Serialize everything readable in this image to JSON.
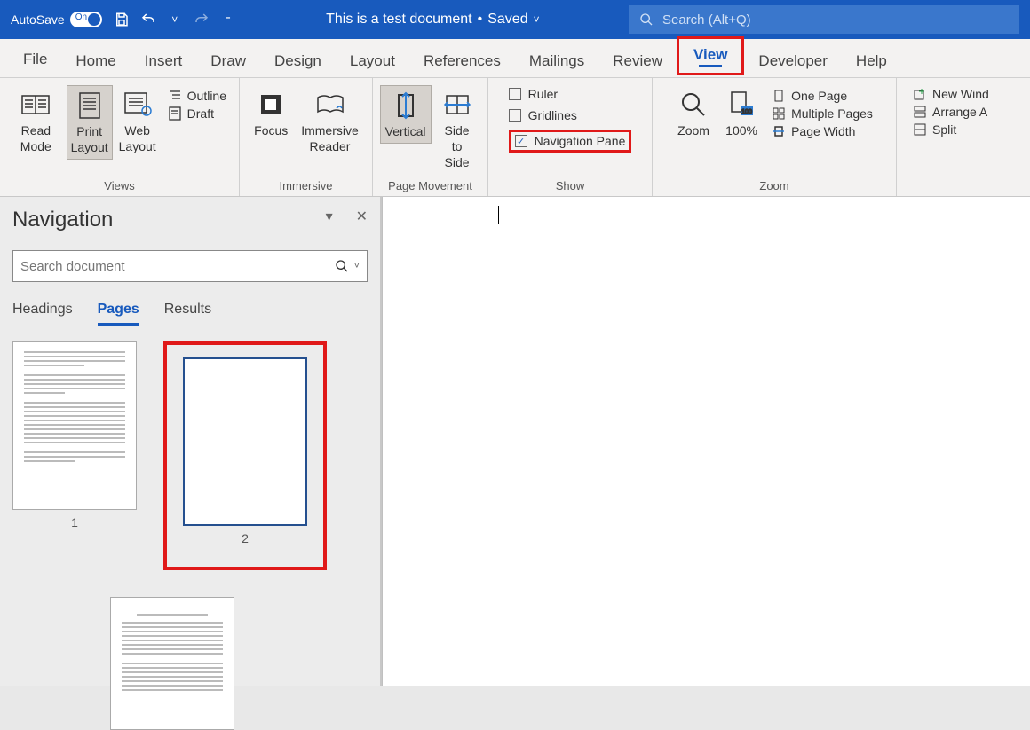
{
  "titlebar": {
    "autosave": "AutoSave",
    "autosave_state": "On",
    "doc_title": "This is a test document",
    "save_state": "Saved",
    "search_placeholder": "Search (Alt+Q)"
  },
  "tabs": {
    "file": "File",
    "home": "Home",
    "insert": "Insert",
    "draw": "Draw",
    "design": "Design",
    "layout": "Layout",
    "references": "References",
    "mailings": "Mailings",
    "review": "Review",
    "view": "View",
    "developer": "Developer",
    "help": "Help"
  },
  "ribbon": {
    "views": {
      "read_mode": "Read Mode",
      "print_layout": "Print Layout",
      "web_layout": "Web Layout",
      "outline": "Outline",
      "draft": "Draft",
      "group_label": "Views"
    },
    "immersive": {
      "focus": "Focus",
      "immersive_reader": "Immersive Reader",
      "group_label": "Immersive"
    },
    "page_movement": {
      "vertical": "Vertical",
      "side_to_side": "Side to Side",
      "group_label": "Page Movement"
    },
    "show": {
      "ruler": "Ruler",
      "gridlines": "Gridlines",
      "navigation_pane": "Navigation Pane",
      "group_label": "Show"
    },
    "zoom": {
      "zoom": "Zoom",
      "hundred": "100%",
      "one_page": "One Page",
      "multiple_pages": "Multiple Pages",
      "page_width": "Page Width",
      "group_label": "Zoom"
    },
    "window": {
      "new_window": "New Wind",
      "arrange_all": "Arrange A",
      "split": "Split"
    }
  },
  "navpane": {
    "title": "Navigation",
    "search_placeholder": "Search document",
    "tabs": {
      "headings": "Headings",
      "pages": "Pages",
      "results": "Results"
    },
    "page1": "1",
    "page2": "2"
  }
}
